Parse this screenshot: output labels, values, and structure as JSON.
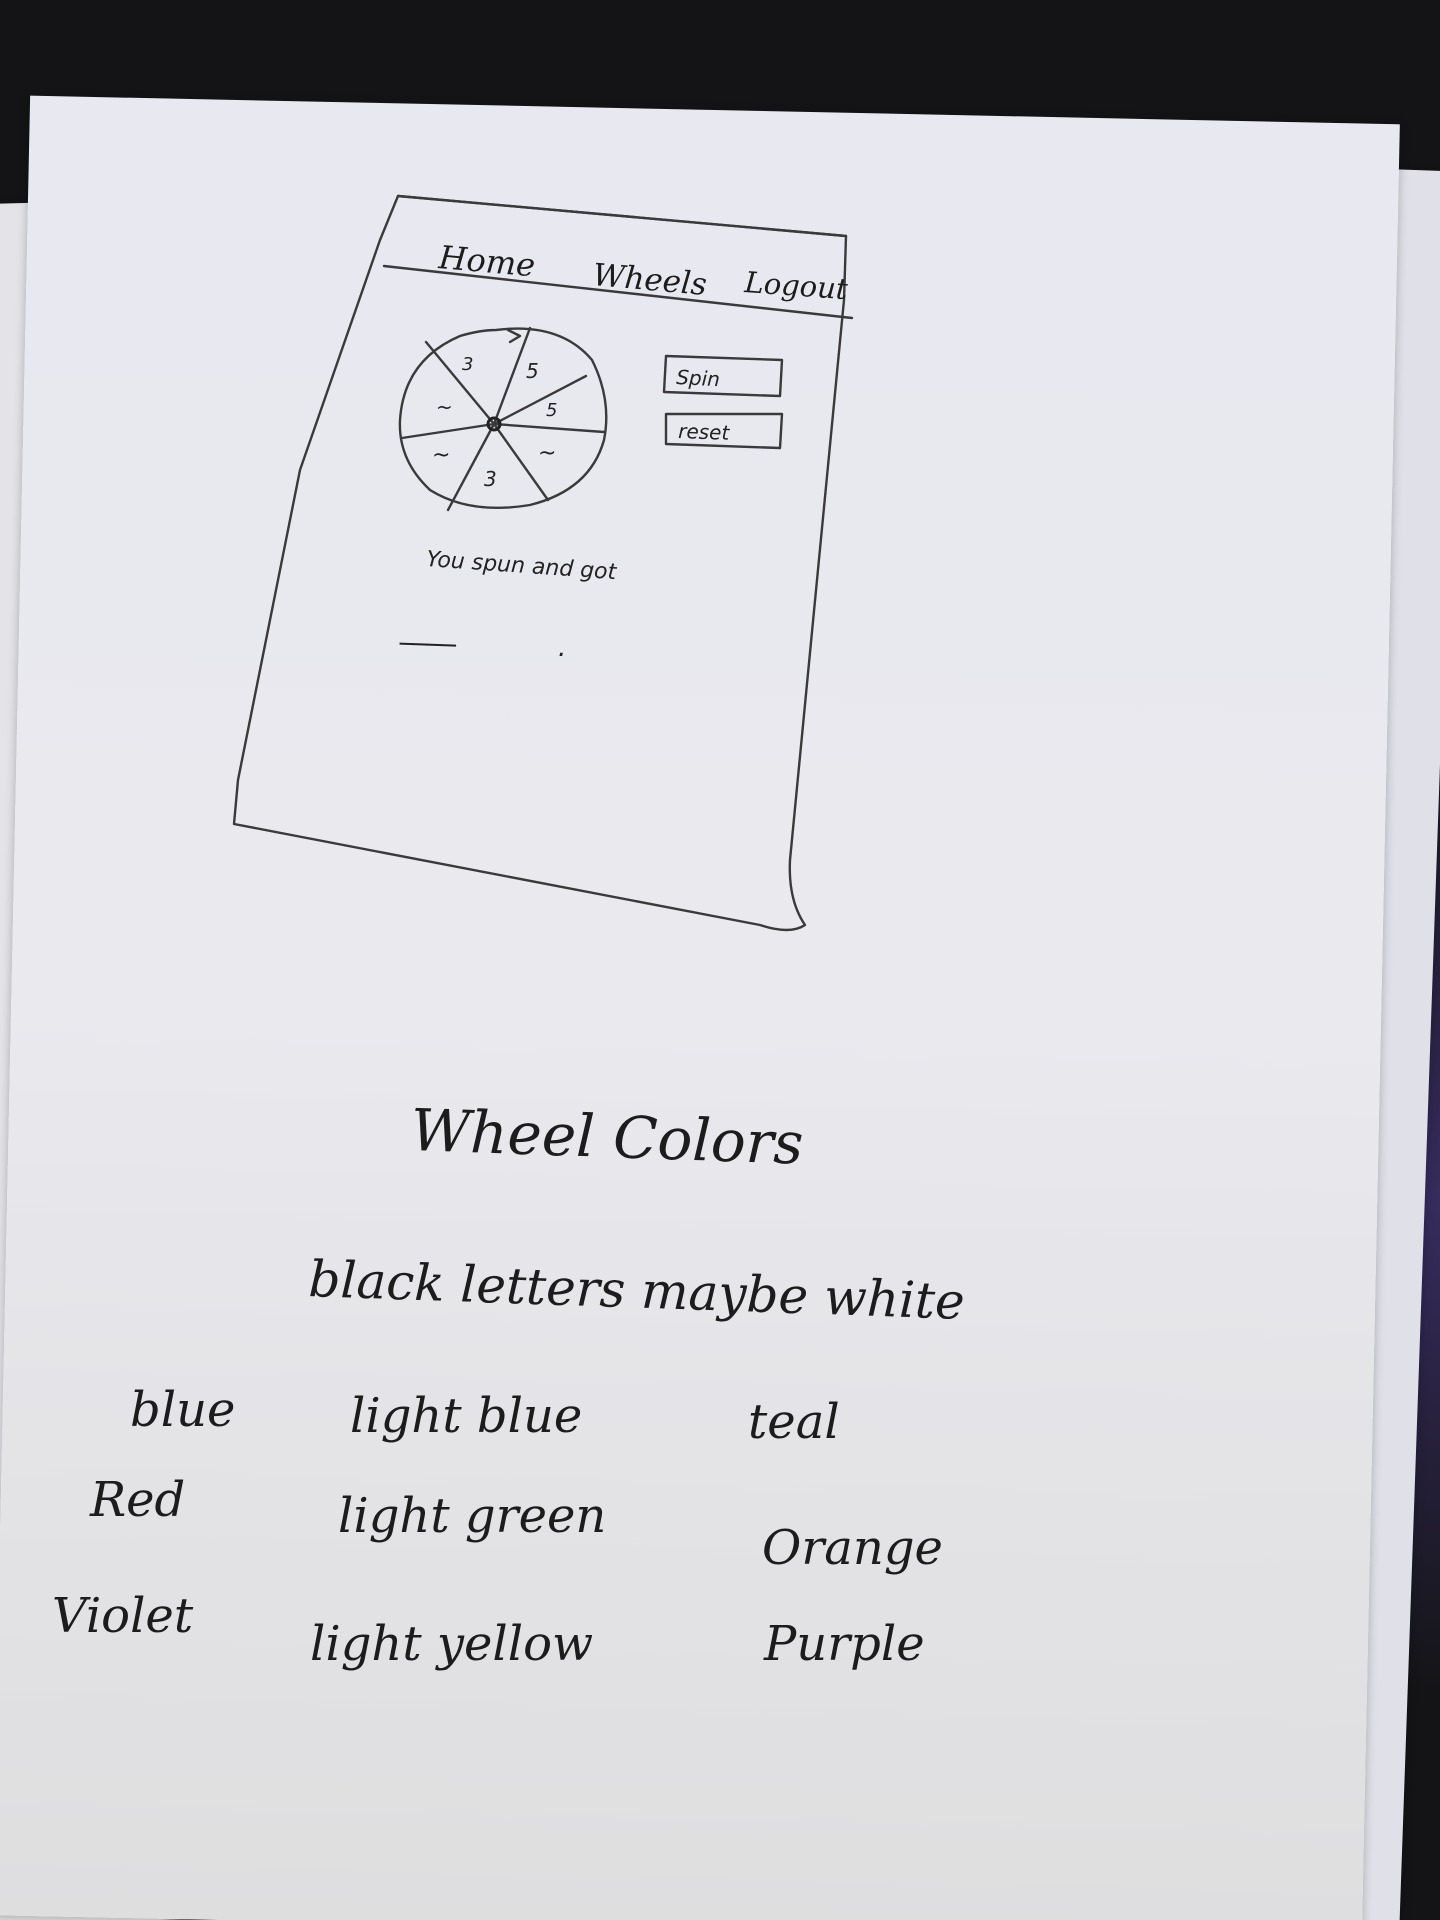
{
  "mockup": {
    "nav": {
      "home": "Home",
      "wheels": "Wheels",
      "logout": "Logout"
    },
    "wheel": {
      "segment_labels": [
        "3",
        "5",
        "5",
        "~",
        "~",
        "~",
        "3"
      ]
    },
    "buttons": {
      "spin": "Spin",
      "reset": "reset"
    },
    "result": {
      "text": "You spun and got",
      "blank": "____",
      "period": "."
    }
  },
  "notes": {
    "heading": "Wheel Colors",
    "letters_note": "black letters maybe white",
    "colors": [
      [
        "blue",
        "light blue",
        "teal"
      ],
      [
        "Red",
        "light green",
        "Orange"
      ],
      [
        "Violet",
        "light yellow",
        "Purple"
      ]
    ]
  }
}
